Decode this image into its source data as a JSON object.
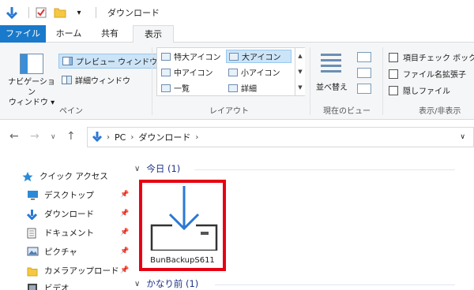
{
  "titlebar": {
    "title": "ダウンロード",
    "qa_dropdown": "▾"
  },
  "tabs": [
    {
      "label": "ファイル"
    },
    {
      "label": "ホーム"
    },
    {
      "label": "共有"
    },
    {
      "label": "表示"
    }
  ],
  "ribbon": {
    "pane": {
      "nav_pane_label_1": "ナビゲーション",
      "nav_pane_label_2": "ウィンドウ ▾",
      "preview_label": "プレビュー ウィンドウ",
      "details_label": "詳細ウィンドウ",
      "group_label": "ペイン"
    },
    "layout": {
      "items": [
        "特大アイコン",
        "大アイコン",
        "中アイコン",
        "小アイコン",
        "一覧",
        "詳細"
      ],
      "selected": "大アイコン",
      "group_label": "レイアウト"
    },
    "current_view": {
      "sort_label": "並べ替え",
      "group_label": "現在のビュー"
    },
    "show_hide": {
      "items": [
        "項目チェック ボックス",
        "ファイル名拡張子",
        "隠しファイル"
      ],
      "group_label": "表示/非表示"
    }
  },
  "address": {
    "segments": [
      "PC",
      "ダウンロード"
    ]
  },
  "nav": {
    "quick_access": "クイック アクセス",
    "items": [
      "デスクトップ",
      "ダウンロード",
      "ドキュメント",
      "ピクチャ",
      "カメラアップロード",
      "ビデオ"
    ]
  },
  "content": {
    "groups": [
      {
        "label": "今日 (1)"
      },
      {
        "label": "かなり前 (1)"
      }
    ],
    "file_name": "BunBackupS611"
  },
  "colors": {
    "accent": "#1979ca",
    "highlight_border": "#e60012",
    "group_text": "#1e3287"
  }
}
